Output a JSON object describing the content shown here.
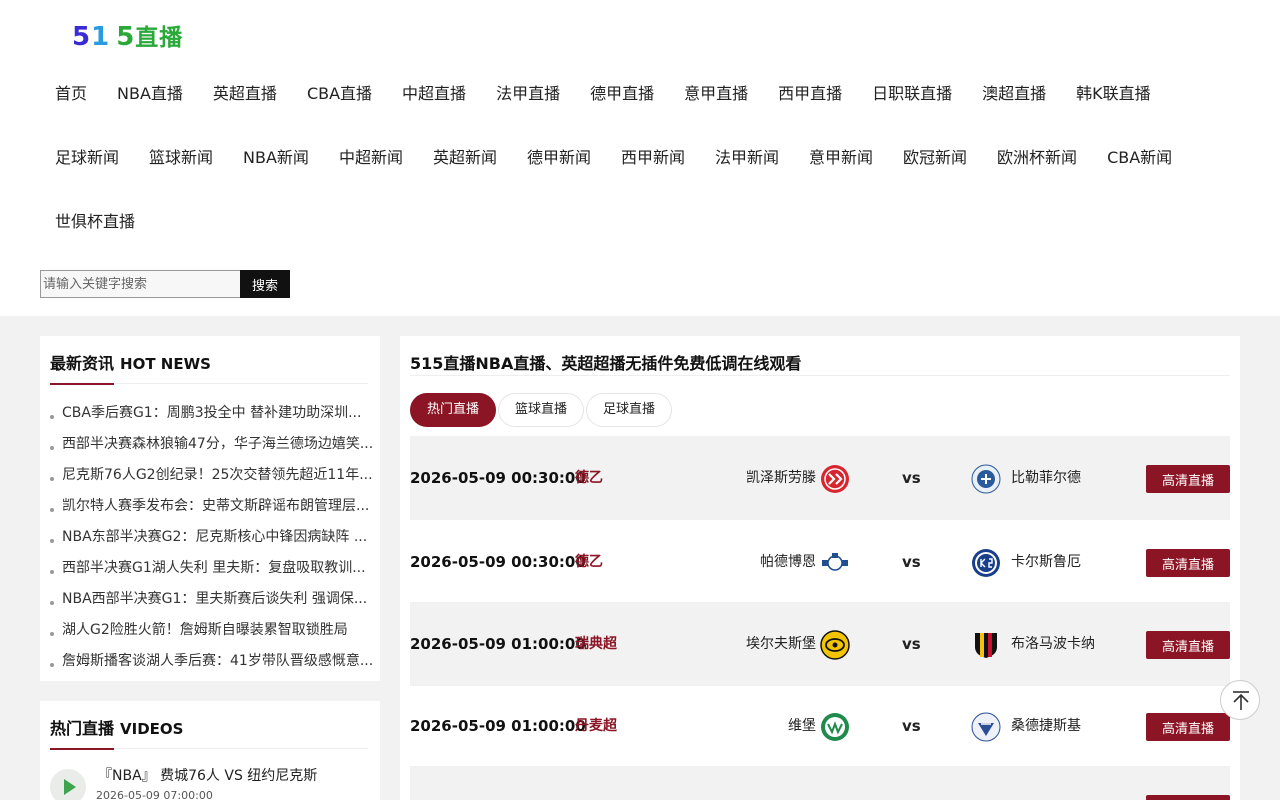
{
  "logo": {
    "p1": "5",
    "p2": "1",
    "p3": "5",
    "p4": "直播"
  },
  "nav": {
    "row1": [
      "首页",
      "NBA直播",
      "英超直播",
      "CBA直播",
      "中超直播",
      "法甲直播",
      "德甲直播",
      "意甲直播",
      "西甲直播",
      "日职联直播",
      "澳超直播",
      "韩K联直播"
    ],
    "row2": [
      "足球新闻",
      "篮球新闻",
      "NBA新闻",
      "中超新闻",
      "英超新闻",
      "德甲新闻",
      "西甲新闻",
      "法甲新闻",
      "意甲新闻",
      "欧冠新闻",
      "欧洲杯新闻",
      "CBA新闻"
    ],
    "row3": [
      "世俱杯直播"
    ]
  },
  "search": {
    "placeholder": "请输入关键字搜索",
    "button": "搜索"
  },
  "news": {
    "title": "最新资讯",
    "title_en": "HOT NEWS",
    "items": [
      "CBA季后赛G1：周鹏3投全中 替补建功助深圳...",
      "西部半决赛森林狼输47分，华子海兰德场边嬉笑...",
      "尼克斯76人G2创纪录！25次交替领先超近11年...",
      "凯尔特人赛季发布会：史蒂文斯辟谣布朗管理层...",
      "NBA东部半决赛G2：尼克斯核心中锋因病缺阵 ...",
      "西部半决赛G1湖人失利 里夫斯：复盘吸取教训...",
      "NBA西部半决赛G1：里夫斯赛后谈失利 强调保...",
      "湖人G2险胜火箭！詹姆斯自曝装累智取锁胜局",
      "詹姆斯播客谈湖人季后赛：41岁带队晋级感慨意..."
    ]
  },
  "videos": {
    "title": "热门直播",
    "title_en": "VIDEOS",
    "items": [
      {
        "title": "『NBA』 费城76人 VS 纽约尼克斯",
        "time": "2026-05-09 07:00:00"
      }
    ]
  },
  "main": {
    "title": "515直播NBA直播、英超超播无插件免费低调在线观看",
    "tabs": [
      "热门直播",
      "篮球直播",
      "足球直播"
    ],
    "vs": "vs",
    "watch_label": "高清直播",
    "matches": [
      {
        "time": "2026-05-09 00:30:00",
        "league": "德乙",
        "home": "凯泽斯劳滕",
        "away": "比勒菲尔德"
      },
      {
        "time": "2026-05-09 00:30:00",
        "league": "德乙",
        "home": "帕德博恩",
        "away": "卡尔斯鲁厄"
      },
      {
        "time": "2026-05-09 01:00:00",
        "league": "瑞典超",
        "home": "埃尔夫斯堡",
        "away": "布洛马波卡纳"
      },
      {
        "time": "2026-05-09 01:00:00",
        "league": "丹麦超",
        "home": "维堡",
        "away": "桑德捷斯基"
      }
    ]
  },
  "colors": {
    "accent": "#8b1524",
    "background": "#f2f2f2"
  }
}
